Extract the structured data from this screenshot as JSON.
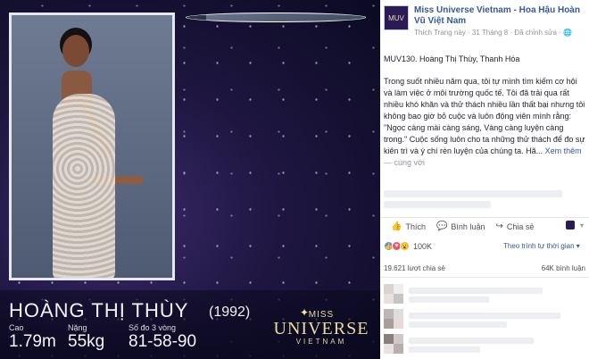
{
  "contestant": {
    "name": "HOÀNG THỊ THÙY",
    "year": "(1992)",
    "height_label": "Cao",
    "height_value": "1.79m",
    "weight_label": "Nặng",
    "weight_value": "55kg",
    "measure_label": "Số đo 3 vòng",
    "measure_value": "81-58-90"
  },
  "logo": {
    "line1": "MISS",
    "line2": "UNIVERSE",
    "line3": "VIETNAM"
  },
  "page": {
    "name": "Miss Universe Vietnam - Hoa Hậu Hoàn Vũ Việt Nam",
    "meta": "Thích Trang này · 31 Tháng 8 · Đã chỉnh sửa · 🌐"
  },
  "post": {
    "line1": "MUV130. Hoàng Thị Thùy, Thanh Hóa",
    "body": "Trong suốt nhiều năm qua, tôi tự mình tìm kiếm cơ hội và làm việc ở môi trường quốc tế. Tôi đã trải qua rất nhiều khó khăn và thử thách nhiều lần thất bại nhưng tôi không bao giờ bỏ cuộc và luôn động viên mình rằng: \"Ngọc càng mài càng sáng, Vàng càng luyện càng trong.\" Cuộc sống luôn cho ta những thử thách để đo sự kiên trì và ý chí rèn luyện của chúng ta. Hã... ",
    "see_more": "Xem thêm",
    "with_text": " — cùng với"
  },
  "actions": {
    "like": "Thích",
    "comment": "Bình luận",
    "share": "Chia sẻ"
  },
  "reactions": {
    "count": "100K",
    "order": "Theo trình tự thời gian ▾"
  },
  "counts": {
    "shares": "19.621 lượt chia sẻ",
    "comments": "64K bình luận"
  },
  "colors": {
    "link": "#365899",
    "like_blue": "#5890ff",
    "love_red": "#f25268",
    "wow_yellow": "#f7b125"
  }
}
